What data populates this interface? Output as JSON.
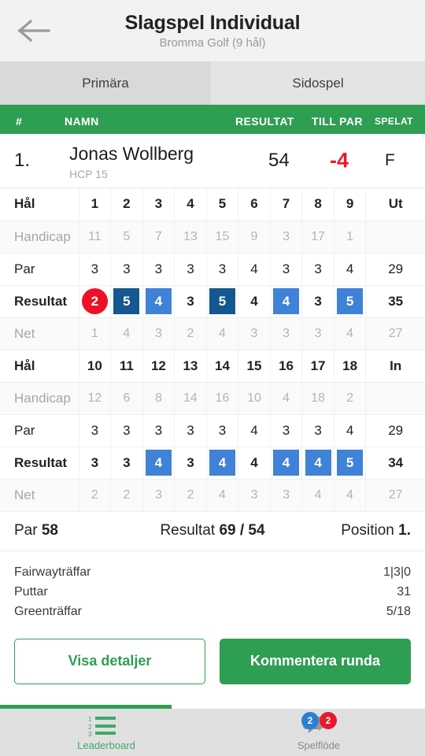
{
  "appbar": {
    "back_icon": "arrow-left-icon",
    "title": "Slagspel Individual",
    "subtitle": "Bromma Golf (9 hål)"
  },
  "tabs": [
    {
      "label": "Primära",
      "active": true
    },
    {
      "label": "Sidospel",
      "active": false
    }
  ],
  "leaderboard_header": {
    "num": "#",
    "name": "NAMN",
    "result": "RESULTAT",
    "to_par": "TILL PAR",
    "played": "SPELAT"
  },
  "player": {
    "rank": "1.",
    "name": "Jonas Wollberg",
    "hcp": "HCP 15",
    "result": "54",
    "to_par": "-4",
    "to_par_color": "#e8192c",
    "played": "F"
  },
  "scorecard": {
    "labels": {
      "hole": "Hål",
      "handicap": "Handicap",
      "par": "Par",
      "result": "Resultat",
      "net": "Net"
    },
    "front": {
      "total_label": "Ut",
      "holes": [
        "1",
        "2",
        "3",
        "4",
        "5",
        "6",
        "7",
        "8",
        "9"
      ],
      "handicap": [
        "11",
        "5",
        "7",
        "13",
        "15",
        "9",
        "3",
        "17",
        "1"
      ],
      "par": [
        "3",
        "3",
        "3",
        "3",
        "3",
        "4",
        "3",
        "3",
        "4"
      ],
      "par_total": "29",
      "result": [
        "2",
        "5",
        "4",
        "3",
        "5",
        "4",
        "4",
        "3",
        "5"
      ],
      "result_style": [
        "circ-red",
        "sq-dark",
        "sq-light",
        "plain",
        "sq-dark",
        "plain",
        "sq-light",
        "plain",
        "sq-light"
      ],
      "result_total": "35",
      "net": [
        "1",
        "4",
        "3",
        "2",
        "4",
        "3",
        "3",
        "3",
        "4"
      ],
      "net_total": "27",
      "handicap_total": ""
    },
    "back": {
      "total_label": "In",
      "holes": [
        "10",
        "11",
        "12",
        "13",
        "14",
        "15",
        "16",
        "17",
        "18"
      ],
      "handicap": [
        "12",
        "6",
        "8",
        "14",
        "16",
        "10",
        "4",
        "18",
        "2"
      ],
      "par": [
        "3",
        "3",
        "3",
        "3",
        "3",
        "4",
        "3",
        "3",
        "4"
      ],
      "par_total": "29",
      "result": [
        "3",
        "3",
        "4",
        "3",
        "4",
        "4",
        "4",
        "4",
        "5"
      ],
      "result_style": [
        "plain",
        "plain",
        "sq-light",
        "plain",
        "sq-light",
        "plain",
        "sq-light",
        "sq-light",
        "sq-light"
      ],
      "result_total": "34",
      "net": [
        "2",
        "2",
        "3",
        "2",
        "4",
        "3",
        "3",
        "4",
        "4"
      ],
      "net_total": "27",
      "handicap_total": ""
    }
  },
  "summary": {
    "par_label": "Par",
    "par_value": "58",
    "result_label": "Resultat",
    "result_value": "69 / 54",
    "position_label": "Position",
    "position_value": "1."
  },
  "stats": [
    {
      "label": "Fairwayträffar",
      "value": "1|3|0"
    },
    {
      "label": "Puttar",
      "value": "31"
    },
    {
      "label": "Greenträffar",
      "value": "5/18"
    }
  ],
  "actions": {
    "details_label": "Visa detaljer",
    "comment_label": "Kommentera runda"
  },
  "bottom_nav": [
    {
      "label": "Leaderboard",
      "icon": "numbered-list-icon",
      "active": true,
      "badges": []
    },
    {
      "label": "Spelflöde",
      "icon": "speech-bubbles-icon",
      "active": false,
      "badges": [
        {
          "value": "2",
          "color": "#2a7fd4"
        },
        {
          "value": "2",
          "color": "#e8192c"
        }
      ]
    }
  ],
  "colors": {
    "brand_green": "#2e9e52",
    "score_dark_blue": "#15578f",
    "score_light_blue": "#3f82d8",
    "score_red": "#ee1125"
  }
}
